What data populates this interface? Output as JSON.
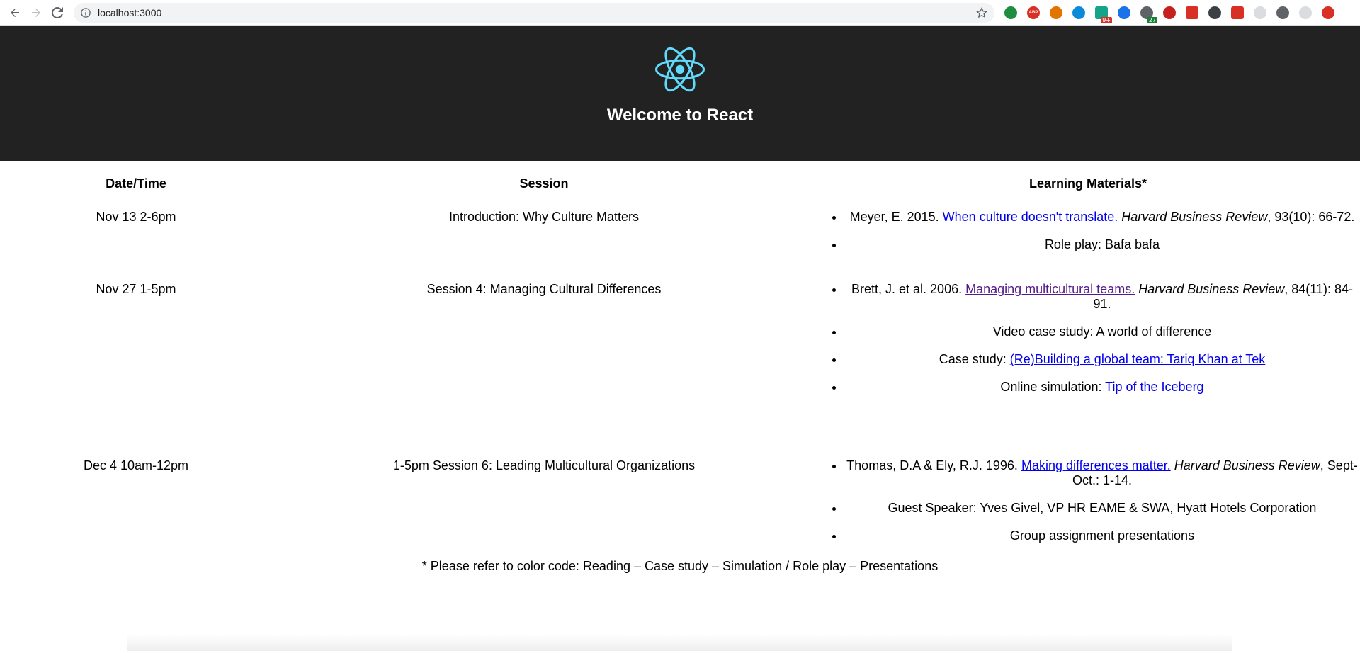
{
  "browser": {
    "url": "localhost:3000",
    "extensions": [
      {
        "name": "green-leaf-icon",
        "color": "#1e8e3e"
      },
      {
        "name": "adblock-icon",
        "color": "#d93025",
        "label": "ABP"
      },
      {
        "name": "chrome-color-icon",
        "color": "#e37400"
      },
      {
        "name": "ring-icon",
        "color": "#0b8ad9"
      },
      {
        "name": "grammar-icon",
        "color": "#15a38a",
        "badge": "9+",
        "badge_color": "#d93025"
      },
      {
        "name": "globe-icon",
        "color": "#1a73e8"
      },
      {
        "name": "person-icon",
        "color": "#5f6368",
        "badge": "27",
        "badge_color": "#188038"
      },
      {
        "name": "pig-icon",
        "color": "#c5221f"
      },
      {
        "name": "mm-icon",
        "color": "#d93025"
      },
      {
        "name": "moon-icon",
        "color": "#3c4043"
      },
      {
        "name": "red-square-icon",
        "color": "#d93025"
      },
      {
        "name": "gray-circle-icon",
        "color": "#dadce0"
      },
      {
        "name": "cast-icon",
        "color": "#5f6368"
      },
      {
        "name": "profile-icon",
        "color": "#dadce0"
      },
      {
        "name": "alert-icon",
        "color": "#d93025"
      }
    ]
  },
  "header": {
    "title": "Welcome to React",
    "logo_color": "#61dafb",
    "background": "#222222"
  },
  "table": {
    "headers": {
      "date": "Date/Time",
      "session": "Session",
      "materials": "Learning Materials*"
    },
    "rows": [
      {
        "date": "Nov 13 2-6pm",
        "session": "Introduction: Why Culture Matters",
        "materials": [
          {
            "pre": "Meyer, E. 2015. ",
            "link": "When culture doesn't translate.",
            "italic": " Harvard Business Review",
            "post": ", 93(10): 66-72."
          },
          {
            "pre": "Role play: Bafa bafa"
          }
        ]
      },
      {
        "date": "Nov 27 1-5pm",
        "session": "Session 4: Managing Cultural Differences",
        "materials": [
          {
            "pre": "Brett, J. et al. 2006. ",
            "link": "Managing multicultural teams.",
            "italic": " Harvard Business Review",
            "post": ", 84(11): 84-91."
          },
          {
            "pre": "Video case study: A world of difference"
          },
          {
            "pre": "Case study: ",
            "link": "(Re)Building a global team: Tariq Khan at Tek"
          },
          {
            "pre": "Online simulation: ",
            "link": "Tip of the Iceberg"
          }
        ]
      },
      {
        "date": "Dec 4 10am-12pm",
        "session": "1-5pm Session 6: Leading Multicultural Organizations",
        "materials": [
          {
            "pre": "Thomas, D.A & Ely, R.J. 1996. ",
            "link": "Making differences matter.",
            "italic": " Harvard Business Review",
            "post": ", Sept-Oct.: 1-14."
          },
          {
            "pre": "Guest Speaker: Yves Givel, VP HR EAME & SWA, Hyatt Hotels Corporation"
          },
          {
            "pre": "Group assignment presentations"
          }
        ]
      }
    ]
  },
  "footnote": "* Please refer to color code: Reading – Case study – Simulation / Role play – Presentations"
}
